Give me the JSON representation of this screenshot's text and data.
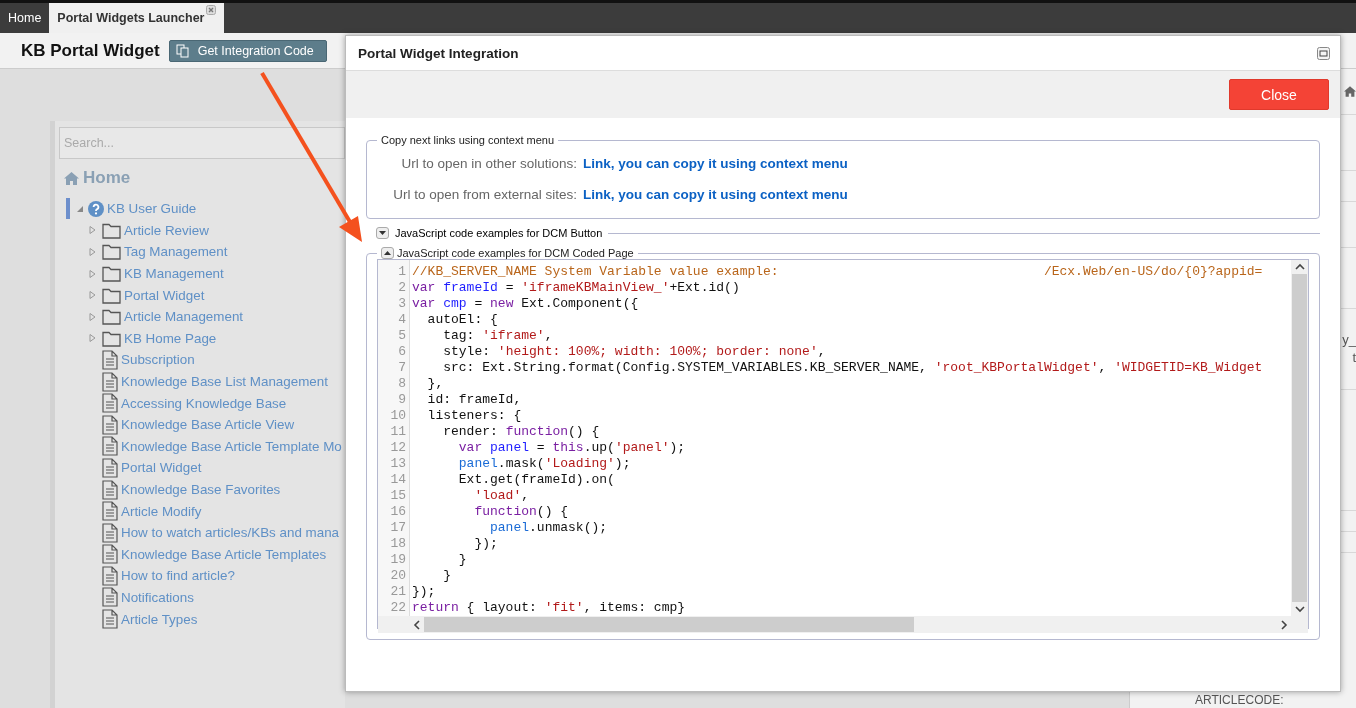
{
  "tabs": [
    {
      "label": "Home",
      "selected": false,
      "closable": false
    },
    {
      "label": "Portal Widgets Launcher",
      "selected": true,
      "closable": true
    }
  ],
  "header": {
    "title": "KB Portal Widget",
    "button": "Get Integration Code"
  },
  "tree": {
    "search": {
      "placeholder": "Search..."
    },
    "heading": "Home",
    "items": [
      {
        "label": "KB User Guide",
        "kind": "guide",
        "expanded": true,
        "selected": true,
        "children": [
          {
            "label": "Article Review",
            "kind": "folder",
            "expanded": false,
            "selected": false
          },
          {
            "label": "Tag Management",
            "kind": "folder",
            "expanded": false,
            "selected": false
          },
          {
            "label": "KB Management",
            "kind": "folder",
            "expanded": false,
            "selected": false
          },
          {
            "label": "Portal Widget",
            "kind": "folder",
            "expanded": false,
            "selected": false
          },
          {
            "label": "Article Management",
            "kind": "folder",
            "expanded": false,
            "selected": false
          },
          {
            "label": "KB Home Page",
            "kind": "folder",
            "expanded": false,
            "selected": false
          },
          {
            "label": "Subscription",
            "kind": "doc",
            "selected": false
          },
          {
            "label": "Knowledge Base List Management",
            "kind": "doc",
            "selected": false
          },
          {
            "label": "Accessing Knowledge Base",
            "kind": "doc",
            "selected": false
          },
          {
            "label": "Knowledge Base Article View",
            "kind": "doc",
            "selected": false
          },
          {
            "label": "Knowledge Base Article Template Mo",
            "kind": "doc",
            "selected": false
          },
          {
            "label": "Portal Widget",
            "kind": "doc",
            "selected": false
          },
          {
            "label": "Knowledge Base Favorites",
            "kind": "doc",
            "selected": false
          },
          {
            "label": "Article Modify",
            "kind": "doc",
            "selected": false
          },
          {
            "label": "How to watch articles/KBs and mana",
            "kind": "doc",
            "selected": false
          },
          {
            "label": "Knowledge Base Article Templates",
            "kind": "doc",
            "selected": false
          },
          {
            "label": "How to find article?",
            "kind": "doc",
            "selected": false
          },
          {
            "label": "Notifications",
            "kind": "doc",
            "selected": false
          },
          {
            "label": "Article Types",
            "kind": "doc",
            "selected": false
          }
        ]
      }
    ]
  },
  "background_panel": {
    "fragments": [
      "y_",
      "t"
    ],
    "field_label": "ARTICLECODE:"
  },
  "dialog": {
    "title": "Portal Widget Integration",
    "close_button": "Close",
    "links_section": {
      "legend": "Copy next links using context menu",
      "rows": [
        {
          "label": "Url to open in other solutions:",
          "link": "Link, you can copy it using context menu"
        },
        {
          "label": "Url to open from external sites:",
          "link": "Link, you can copy it using context menu"
        }
      ]
    },
    "code_sections": [
      {
        "legend": "JavaScript code examples for DCM Button",
        "expanded": false
      },
      {
        "legend": "JavaScript code examples for DCM Coded Page",
        "expanded": true,
        "code": [
          {
            "number": "1",
            "tokens": [
              {
                "kind": "comment",
                "text": "//KB_SERVER_NAME System Variable value example:                                  /Ecx.Web/en-US/do/{0}?appid="
              }
            ]
          },
          {
            "number": "2",
            "tokens": [
              {
                "kind": "keyword",
                "text": "var"
              },
              {
                "kind": "def",
                "text": " frameId"
              },
              {
                "kind": "plain",
                "text": " = "
              },
              {
                "kind": "string",
                "text": "'iframeKBMainView_'"
              },
              {
                "kind": "plain",
                "text": "+Ext.id()"
              }
            ]
          },
          {
            "number": "3",
            "tokens": [
              {
                "kind": "keyword",
                "text": "var"
              },
              {
                "kind": "def",
                "text": " cmp"
              },
              {
                "kind": "plain",
                "text": " = "
              },
              {
                "kind": "keyword",
                "text": "new"
              },
              {
                "kind": "plain",
                "text": " Ext.Component({"
              }
            ]
          },
          {
            "number": "4",
            "tokens": [
              {
                "kind": "plain",
                "text": "  autoEl: {"
              }
            ]
          },
          {
            "number": "5",
            "tokens": [
              {
                "kind": "plain",
                "text": "    tag: "
              },
              {
                "kind": "string",
                "text": "'iframe'"
              },
              {
                "kind": "plain",
                "text": ","
              }
            ]
          },
          {
            "number": "6",
            "tokens": [
              {
                "kind": "plain",
                "text": "    style: "
              },
              {
                "kind": "string",
                "text": "'height: 100%; width: 100%; border: none'"
              },
              {
                "kind": "plain",
                "text": ","
              }
            ]
          },
          {
            "number": "7",
            "tokens": [
              {
                "kind": "plain",
                "text": "    src: Ext.String.format(Config.SYSTEM_VARIABLES.KB_SERVER_NAME, "
              },
              {
                "kind": "string",
                "text": "'root_KBPortalWidget'"
              },
              {
                "kind": "plain",
                "text": ", "
              },
              {
                "kind": "string",
                "text": "'WIDGETID=KB_Widget"
              }
            ]
          },
          {
            "number": "8",
            "tokens": [
              {
                "kind": "plain",
                "text": "  },"
              }
            ]
          },
          {
            "number": "9",
            "tokens": [
              {
                "kind": "plain",
                "text": "  id: frameId,"
              }
            ]
          },
          {
            "number": "10",
            "tokens": [
              {
                "kind": "plain",
                "text": "  listeners: {"
              }
            ]
          },
          {
            "number": "11",
            "tokens": [
              {
                "kind": "plain",
                "text": "    render: "
              },
              {
                "kind": "keyword",
                "text": "function"
              },
              {
                "kind": "plain",
                "text": "() {"
              }
            ]
          },
          {
            "number": "12",
            "tokens": [
              {
                "kind": "keyword",
                "text": "      var"
              },
              {
                "kind": "def",
                "text": " panel"
              },
              {
                "kind": "plain",
                "text": " = "
              },
              {
                "kind": "keyword",
                "text": "this"
              },
              {
                "kind": "plain",
                "text": ".up("
              },
              {
                "kind": "string",
                "text": "'panel'"
              },
              {
                "kind": "plain",
                "text": ");"
              }
            ]
          },
          {
            "number": "13",
            "tokens": [
              {
                "kind": "var",
                "text": "      panel"
              },
              {
                "kind": "plain",
                "text": ".mask("
              },
              {
                "kind": "string",
                "text": "'Loading'"
              },
              {
                "kind": "plain",
                "text": ");"
              }
            ]
          },
          {
            "number": "14",
            "tokens": [
              {
                "kind": "plain",
                "text": "      Ext.get(frameId).on("
              }
            ]
          },
          {
            "number": "15",
            "tokens": [
              {
                "kind": "string",
                "text": "        'load'"
              },
              {
                "kind": "plain",
                "text": ","
              }
            ]
          },
          {
            "number": "16",
            "tokens": [
              {
                "kind": "keyword",
                "text": "        function"
              },
              {
                "kind": "plain",
                "text": "() {"
              }
            ]
          },
          {
            "number": "17",
            "tokens": [
              {
                "kind": "var",
                "text": "          panel"
              },
              {
                "kind": "plain",
                "text": ".unmask();"
              }
            ]
          },
          {
            "number": "18",
            "tokens": [
              {
                "kind": "plain",
                "text": "        });"
              }
            ]
          },
          {
            "number": "19",
            "tokens": [
              {
                "kind": "plain",
                "text": "      }"
              }
            ]
          },
          {
            "number": "20",
            "tokens": [
              {
                "kind": "plain",
                "text": "    }"
              }
            ]
          },
          {
            "number": "21",
            "tokens": [
              {
                "kind": "plain",
                "text": "});"
              }
            ]
          },
          {
            "number": "22",
            "tokens": [
              {
                "kind": "keyword",
                "text": "return"
              },
              {
                "kind": "plain",
                "text": " { layout: "
              },
              {
                "kind": "string",
                "text": "'fit'"
              },
              {
                "kind": "plain",
                "text": ", items: cmp}"
              }
            ]
          }
        ]
      }
    ]
  }
}
